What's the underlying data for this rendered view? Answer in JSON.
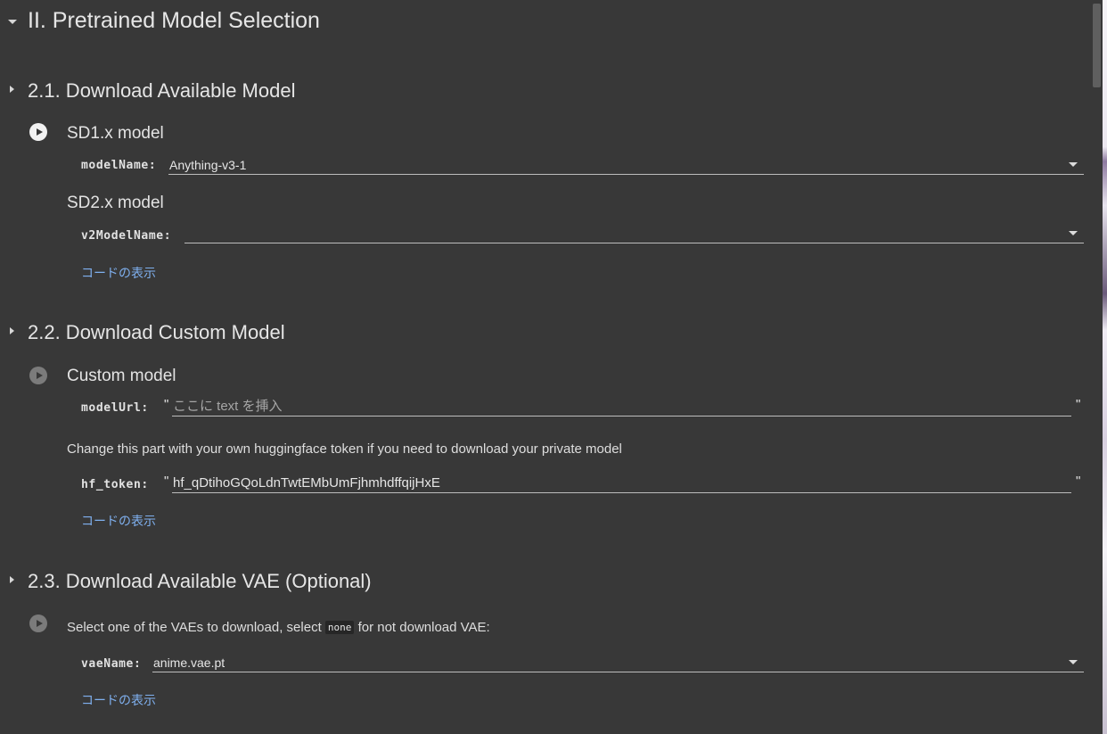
{
  "section": {
    "title": "II. Pretrained Model Selection"
  },
  "subsections": [
    {
      "title": "2.1. Download Available Model",
      "cells": [
        {
          "heading": "SD1.x model",
          "field_label": "modelName:",
          "field_value": "Anything-v3-1"
        },
        {
          "heading": "SD2.x model",
          "field_label": "v2ModelName:",
          "field_value": ""
        }
      ],
      "show_code": "コードの表示"
    },
    {
      "title": "2.2. Download Custom Model",
      "heading": "Custom model",
      "model_url_label": "modelUrl:",
      "model_url_placeholder": "ここに text を挿入",
      "model_url_value": "",
      "note": "Change this part with your own huggingface token if you need to download your private model",
      "hf_token_label": "hf_token:",
      "hf_token_value": "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",
      "quote_open": "\"",
      "quote_close": "\"",
      "show_code": "コードの表示"
    },
    {
      "title": "2.3. Download Available VAE (Optional)",
      "description_before": "Select one of the VAEs to download, select",
      "description_code": "none",
      "description_after": "for not download VAE:",
      "field_label": "vaeName:",
      "field_value": "anime.vae.pt",
      "show_code": "コードの表示"
    }
  ],
  "icons": {
    "collapse": "chevron-down-icon",
    "expand": "chevron-right-icon",
    "run": "play-circle-icon"
  }
}
